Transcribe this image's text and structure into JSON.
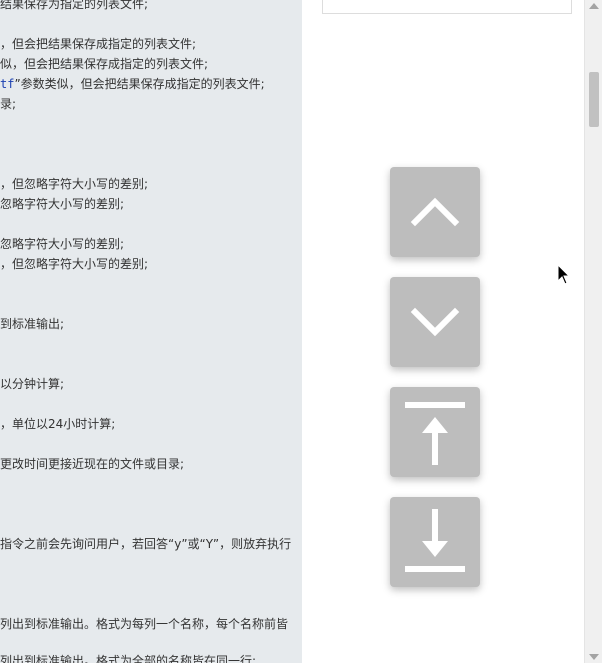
{
  "code_lines": [
    {
      "y": 0,
      "pre": "结果保存为指定的列表文件;"
    },
    {
      "pre": "，但会把结果保存成指定的列表文件;"
    },
    {
      "pre": "似，但会把结果保存成指定的列表文件;"
    },
    {
      "pre": "",
      "kw": "tf",
      "post": "”参数类似，但会把结果保存成指定的列表文件;"
    },
    {
      "pre": "录;"
    },
    {
      "pre": "，但忽略字符大小写的差别;"
    },
    {
      "pre": "忽略字符大小写的差别;"
    },
    {
      "pre": "忽略字符大小写的差别;"
    },
    {
      "pre": "，但忽略字符大小写的差别;"
    },
    {
      "pre": "到标准输出;"
    },
    {
      "pre": "以分钟计算;"
    },
    {
      "pre": "，单位以24小时计算;"
    },
    {
      "pre": "更改时间更接近现在的文件或目录;"
    },
    {
      "pre": "指令之前会先询问用户，若回答“y”或“Y”，则放弃执行"
    },
    {
      "pre": "列出到标准输出。格式为每列一个名称，每个名称前皆"
    },
    {
      "pre": "列出到标准输出。格式为全部的名称皆在同一行;"
    }
  ],
  "nav_buttons": [
    {
      "name": "scroll-up-button",
      "icon": "chevron-up-icon"
    },
    {
      "name": "scroll-down-button",
      "icon": "chevron-down-icon"
    },
    {
      "name": "scroll-to-top-button",
      "icon": "arrow-to-top-icon"
    },
    {
      "name": "scroll-to-bottom-button",
      "icon": "arrow-to-bottom-icon"
    }
  ],
  "colors": {
    "panel_bg": "#e6eaed",
    "button_bg": "#bdbdbd",
    "keyword": "#1a3fb0"
  }
}
